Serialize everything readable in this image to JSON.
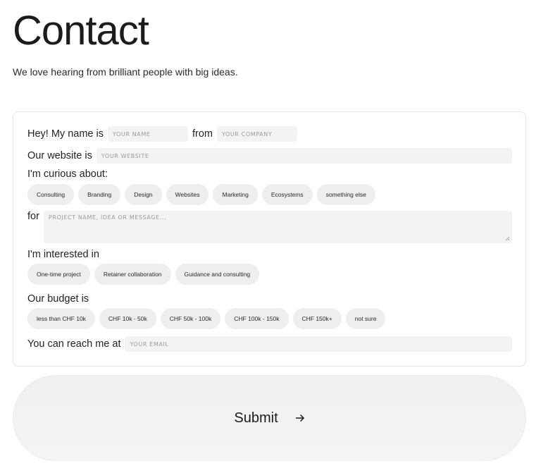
{
  "page": {
    "title": "Contact",
    "intro": "We love hearing from brilliant people with big ideas."
  },
  "form": {
    "name_prefix": "Hey! My name is",
    "name_placeholder": "YOUR NAME",
    "from_label": "from",
    "company_placeholder": "YOUR COMPANY",
    "website_label": "Our website is",
    "website_placeholder": "YOUR WEBSITE",
    "curious_label": "I'm curious about:",
    "curious_options": [
      "Consulting",
      "Branding",
      "Design",
      "Websites",
      "Marketing",
      "Ecosystems",
      "something else"
    ],
    "for_label": "for",
    "message_placeholder": "PROJECT NAME, IDEA OR MESSAGE...",
    "interested_label": "I'm interested in",
    "interested_options": [
      "One-time project",
      "Retainer collaboration",
      "Guidance and consulting"
    ],
    "budget_label": "Our budget is",
    "budget_options": [
      "less than CHF 10k",
      "CHF 10k - 50k",
      "CHF 50k - 100k",
      "CHF 100k - 150k",
      "CHF 150k+",
      "not sure"
    ],
    "reach_label": "You can reach me at",
    "email_placeholder": "YOUR EMAIL"
  },
  "submit": {
    "label": "Submit",
    "icon": "arrow-right-icon"
  }
}
